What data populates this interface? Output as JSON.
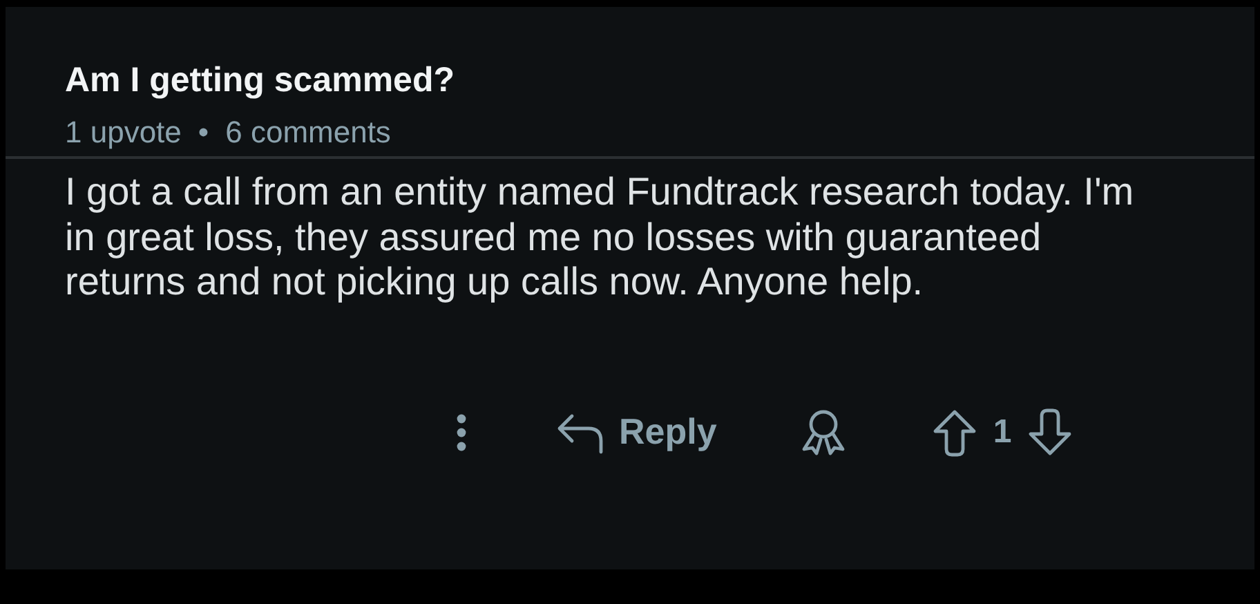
{
  "post": {
    "title": "Am I getting scammed?",
    "upvotes": "1 upvote",
    "separator": "•",
    "comments": "6 comments",
    "body": "I got a call from an entity named Fundtrack research today. I'm in great loss, they assured me no losses with guaranteed returns and not picking up calls now. Anyone help."
  },
  "actions": {
    "reply": "Reply",
    "score": "1"
  }
}
